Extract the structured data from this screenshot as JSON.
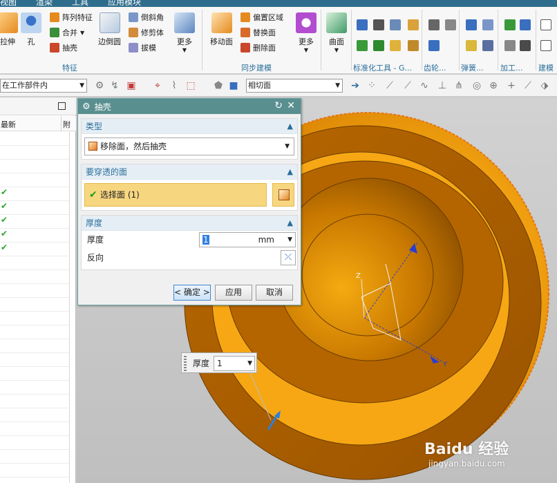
{
  "menu": {
    "items": [
      "视图",
      "渲染",
      "工具",
      "应用模块"
    ]
  },
  "ribbon": {
    "feature_group": {
      "label": "特征",
      "buttons": [
        "拉伸",
        "孔",
        "边倒圆",
        "更多"
      ],
      "small": [
        "阵列特征",
        "合并",
        "抽壳",
        "倒斜角",
        "修剪体",
        "拔模"
      ]
    },
    "sync_group": {
      "label": "同步建模",
      "buttons": [
        "移动面",
        "更多"
      ],
      "small": [
        "偏置区域",
        "替换面",
        "删除面"
      ]
    },
    "surface_button": "曲面",
    "other_groups": [
      "标准化工具 - G...",
      "齿轮...",
      "弹簧...",
      "加工...",
      "建模工"
    ]
  },
  "toolbar2": {
    "scope_combo": "在工作部件内",
    "face_rule_combo": "相切面"
  },
  "left_panel": {
    "col_header": "最新",
    "col_header2": "附",
    "checks": [
      "✔",
      "✔",
      "✔",
      "✔",
      "✔"
    ]
  },
  "dialog": {
    "title": "抽壳",
    "type_section": {
      "title": "类型",
      "value": "移除面，然后抽壳"
    },
    "faces_section": {
      "title": "要穿透的面",
      "select_label": "选择面 (1)"
    },
    "thickness_section": {
      "title": "厚度",
      "thickness_label": "厚度",
      "thickness_value": "1",
      "unit": "mm",
      "reverse_label": "反向"
    },
    "buttons": {
      "ok": "< 确定 >",
      "apply": "应用",
      "cancel": "取消"
    }
  },
  "floating_field": {
    "label": "厚度",
    "value": "1"
  },
  "viewport": {
    "axis_labels": {
      "z": "Z",
      "y": "Y"
    }
  },
  "watermark": {
    "brand": "Baidu 经验",
    "url": "jingyan.baidu.com"
  }
}
